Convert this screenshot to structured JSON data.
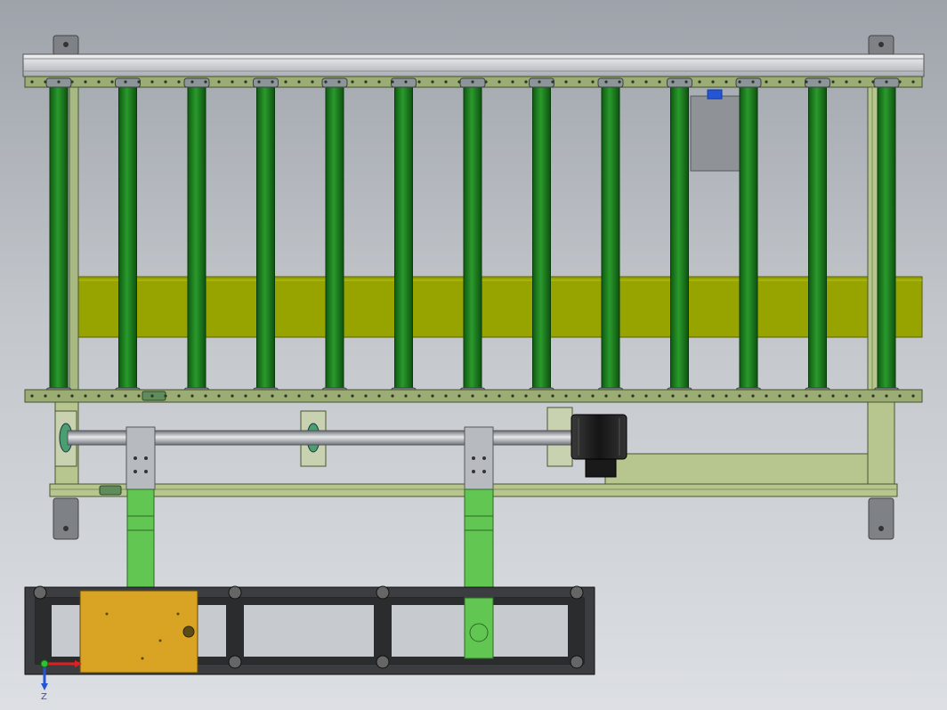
{
  "model": {
    "roller_count": 13,
    "colors": {
      "roller_green": "#1b7a1b",
      "roller_light": "#2fa52f",
      "frame_olive": "#9bac74",
      "frame_light": "#b6c68e",
      "rail_silver": "#d8dbde",
      "guide_yellow": "#97a400",
      "leg_green": "#62c652",
      "motor_black": "#1c1c1c",
      "control_box": "#d9a423",
      "base_dark": "#2a2c2e",
      "accent_blue": "#2355d6",
      "axis_red": "#e02020"
    },
    "icons": {
      "triad": "coordinate-triad-icon",
      "motor": "gear-motor-icon"
    }
  },
  "triad": {
    "z_label": "Z"
  }
}
